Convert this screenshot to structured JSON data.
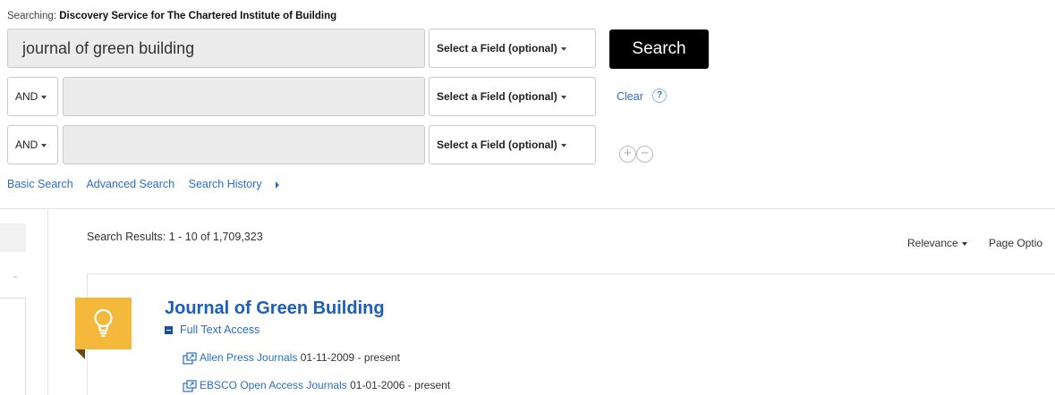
{
  "searching": {
    "prefix": "Searching:",
    "service": "Discovery Service for The Chartered Institute of Building"
  },
  "query": {
    "main_value": "journal of green building",
    "row2_value": "",
    "row3_value": ""
  },
  "field_select": {
    "label": "Select a Field (optional)"
  },
  "bool_ops": {
    "row2": "AND",
    "row3": "AND"
  },
  "search_button": {
    "label": "Search"
  },
  "clear_link": "Clear",
  "help_icon": "?",
  "add_row_button": "+",
  "remove_row_button": "−",
  "nav_links": {
    "basic": "Basic Search",
    "advanced": "Advanced Search",
    "history": "Search History"
  },
  "results": {
    "count_text": "Search Results: 1 - 10 of 1,709,323",
    "sort_label": "Relevance",
    "page_options": "Page Optio"
  },
  "result": {
    "title": "Journal of Green Building",
    "full_text_label": "Full Text Access",
    "holdings": [
      {
        "source": "Allen Press Journals",
        "dates": "01-11-2009 - present"
      },
      {
        "source": "EBSCO Open Access Journals",
        "dates": "01-01-2006 - present"
      }
    ]
  },
  "colors": {
    "link": "#2a6fc9",
    "title": "#1a5fb8",
    "search_button": "#000000",
    "badge": "#f4b83a"
  },
  "icons": [
    "help-icon",
    "plus-icon",
    "minus-icon",
    "chevron-down-icon",
    "lightbulb-icon",
    "collapse-icon",
    "external-link-icon",
    "caret-right-icon"
  ]
}
